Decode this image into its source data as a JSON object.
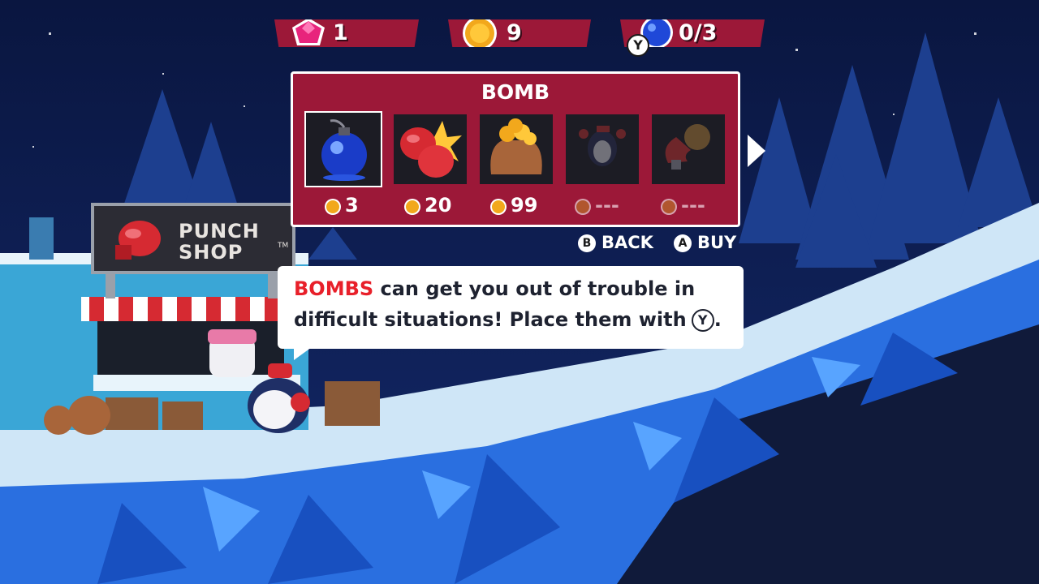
{
  "hud": {
    "gems": "1",
    "coins": "9",
    "bombs": "0/3",
    "bomb_button": "Y"
  },
  "shop": {
    "title": "BOMB",
    "items": [
      {
        "icon": "bomb-icon",
        "price": "3"
      },
      {
        "icon": "boxing-gloves-icon",
        "price": "20"
      },
      {
        "icon": "coin-bag-icon",
        "price": "99"
      },
      {
        "icon": "jetpack-penguin-icon",
        "price": "---"
      },
      {
        "icon": "magnet-icon",
        "price": "---"
      }
    ],
    "selected_index": 0
  },
  "prompts": {
    "back_button": "B",
    "back_label": "BACK",
    "buy_button": "A",
    "buy_label": "BUY"
  },
  "dialogue": {
    "highlight": "BOMBS",
    "line1_rest": " can get you out of trouble in",
    "line2": "difficult situations! Place them with",
    "button": "Y",
    "end": "."
  },
  "sign": {
    "title": "PUNCH\nSHOP",
    "tm": "TM"
  },
  "colors": {
    "panel": "#9c1838",
    "highlight_text": "#e8202a",
    "sky": "#0c1a45",
    "snow": "#cfe6f7",
    "ice": "#2a6fe0"
  }
}
